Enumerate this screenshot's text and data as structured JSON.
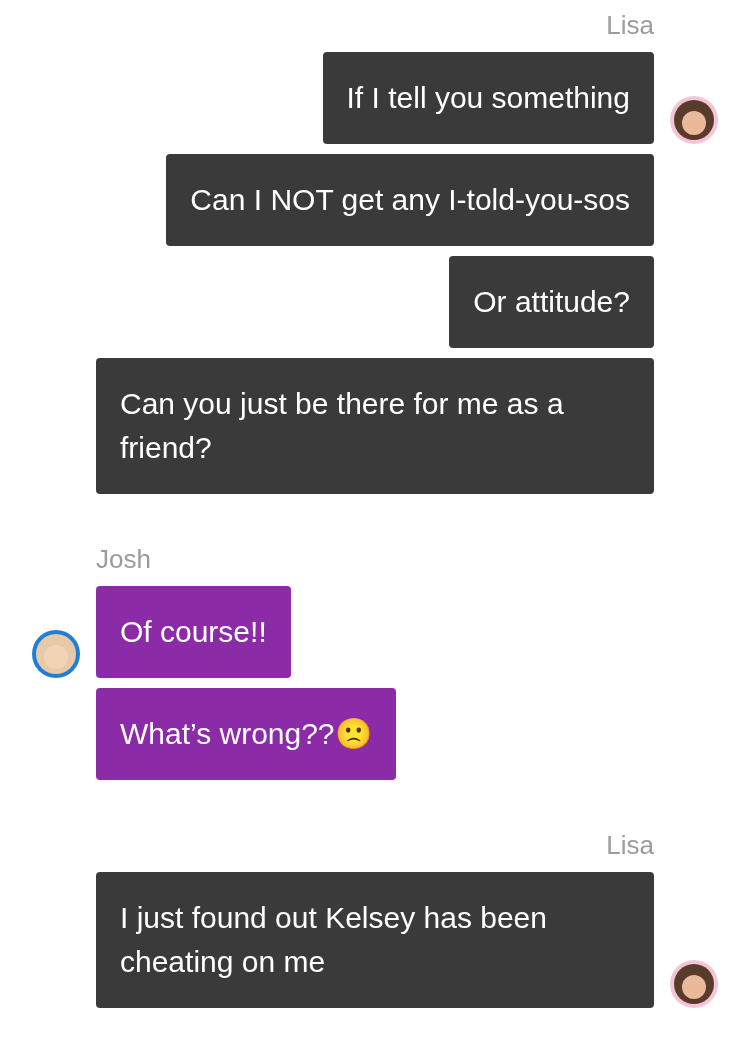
{
  "groups": [
    {
      "kind": "outgoing",
      "sender": "Lisa",
      "messages": [
        "If I tell you something",
        "Can I NOT get any I-told-you-sos",
        "Or attitude?",
        "Can you just be there for me as a friend?"
      ]
    },
    {
      "kind": "incoming",
      "sender": "Josh",
      "messages": [
        "Of course!!",
        "What’s wrong??🙁"
      ]
    },
    {
      "kind": "outgoing",
      "sender": "Lisa",
      "messages": [
        "I just found out Kelsey has been cheating on me"
      ]
    }
  ]
}
